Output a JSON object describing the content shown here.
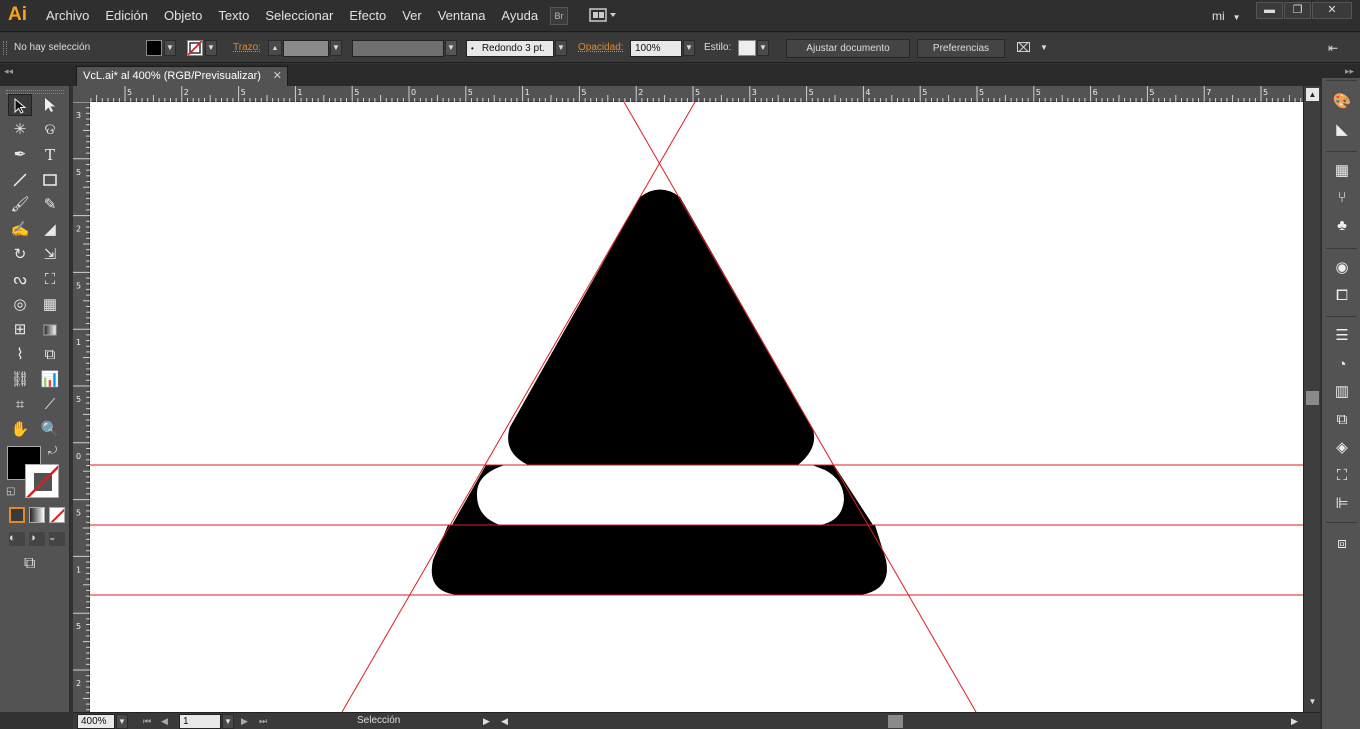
{
  "app": {
    "logo": "Ai"
  },
  "menu": [
    "Archivo",
    "Edición",
    "Objeto",
    "Texto",
    "Seleccionar",
    "Efecto",
    "Ver",
    "Ventana",
    "Ayuda"
  ],
  "menubar": {
    "bridge_label": "Br",
    "workspace_user": "mi"
  },
  "control": {
    "selection_status": "No hay selección",
    "stroke_label": "Trazo:",
    "brush_value": "Redondo 3 pt.",
    "opacity_label": "Opacidad:",
    "opacity_value": "100%",
    "style_label": "Estilo:",
    "document_setup_button": "Ajustar documento",
    "preferences_button": "Preferencias"
  },
  "document": {
    "tab_title": "VcL.ai* al 400% (RGB/Previsualizar)"
  },
  "rulers": {
    "top": [
      "5",
      "2",
      "5",
      "1",
      "5",
      "0",
      "5",
      "1",
      "5",
      "2",
      "5",
      "3",
      "5",
      "4",
      "5",
      "5",
      "5",
      "6",
      "5",
      "7",
      "5"
    ],
    "left": [
      "3",
      "5",
      "2",
      "5",
      "1",
      "5",
      "0",
      "5",
      "1",
      "5",
      "2"
    ]
  },
  "status": {
    "zoom": "400%",
    "page": "1",
    "tool_status": "Selección"
  },
  "colors": {
    "guide": "#e11b22",
    "fill": "#000000",
    "accent": "#f7a21b"
  }
}
